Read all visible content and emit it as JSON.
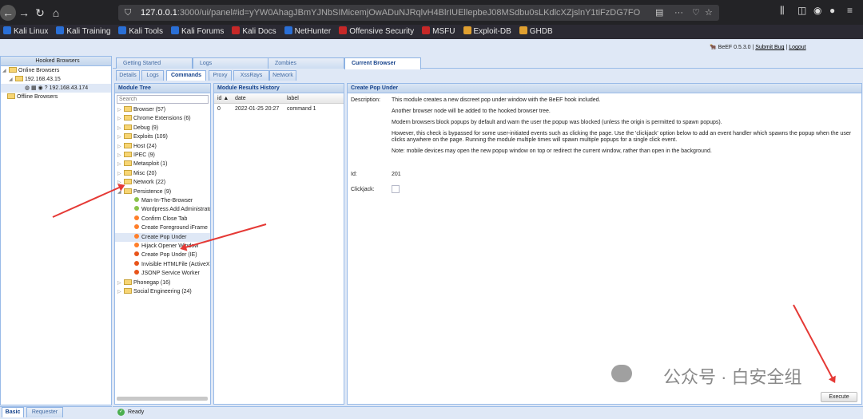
{
  "browser": {
    "url_host": "127.0.0.1",
    "url_rest": ":3000/ui/panel#id=yYW0AhagJBmYJNbSIMicemjOwADuNJRqlvH4BlrIUEllepbeJ08MSdbu0sLKdlcXZjslnY1tiFzDG7FO",
    "bookmarks": [
      "Kali Linux",
      "Kali Training",
      "Kali Tools",
      "Kali Forums",
      "Kali Docs",
      "NetHunter",
      "Offensive Security",
      "MSFU",
      "Exploit-DB",
      "GHDB"
    ]
  },
  "header": {
    "brand": "BeEF",
    "version": "0.5.3.0",
    "submit_bug": "Submit Bug",
    "logout": "Logout",
    "sep": "|"
  },
  "hooked": {
    "title": "Hooked Browsers",
    "online": "Online Browsers",
    "ip_group": "192.168.43.15",
    "client": "192.168.43.174",
    "offline": "Offline Browsers"
  },
  "left_tabs": {
    "basic": "Basic",
    "requester": "Requester"
  },
  "main_tabs": [
    "Getting Started",
    "Logs",
    "Zombies",
    "Current Browser"
  ],
  "sub_tabs": [
    "Details",
    "Logs",
    "Commands",
    "Proxy",
    "XssRays",
    "Network"
  ],
  "module_tree": {
    "title": "Module Tree",
    "search_placeholder": "Search",
    "folders_top": [
      "Browser (57)",
      "Chrome Extensions (6)",
      "Debug (9)",
      "Exploits (109)",
      "Host (24)",
      "IPEC (9)",
      "Metasploit (1)",
      "Misc (20)",
      "Network (22)",
      "Persistence (9)"
    ],
    "persistence_items": [
      "Man-In-The-Browser",
      "Wordpress Add Administrator",
      "Confirm Close Tab",
      "Create Foreground iFrame",
      "Create Pop Under",
      "Hijack Opener Window",
      "Create Pop Under (IE)",
      "Invisible HTMLFile (ActiveX)",
      "JSONP Service Worker"
    ],
    "folders_bottom": [
      "Phonegap (16)",
      "Social Engineering (24)"
    ]
  },
  "results": {
    "title": "Module Results History",
    "cols": [
      "id",
      "date",
      "label"
    ],
    "rows": [
      [
        "0",
        "2022-01-25 20:27",
        "command 1"
      ]
    ]
  },
  "detail": {
    "title": "Create Pop Under",
    "desc_label": "Description:",
    "desc": [
      "This module creates a new discreet pop under window with the BeEF hook included.",
      "Another browser node will be added to the hooked browser tree.",
      "Modern browsers block popups by default and warn the user the popup was blocked (unless the origin is permitted to spawn popups).",
      "However, this check is bypassed for some user-initiated events such as clicking the page. Use the 'clickjack' option below to add an event handler which spawns the popup when the user clicks anywhere on the page. Running the module multiple times will spawn multiple popups for a single click event.",
      "Note: mobile devices may open the new popup window on top or redirect the current window, rather than open in the background."
    ],
    "id_label": "Id:",
    "id": "201",
    "clickjack_label": "Clickjack:",
    "execute": "Execute"
  },
  "status": "Ready",
  "watermark": "公众号 · 白安全组"
}
